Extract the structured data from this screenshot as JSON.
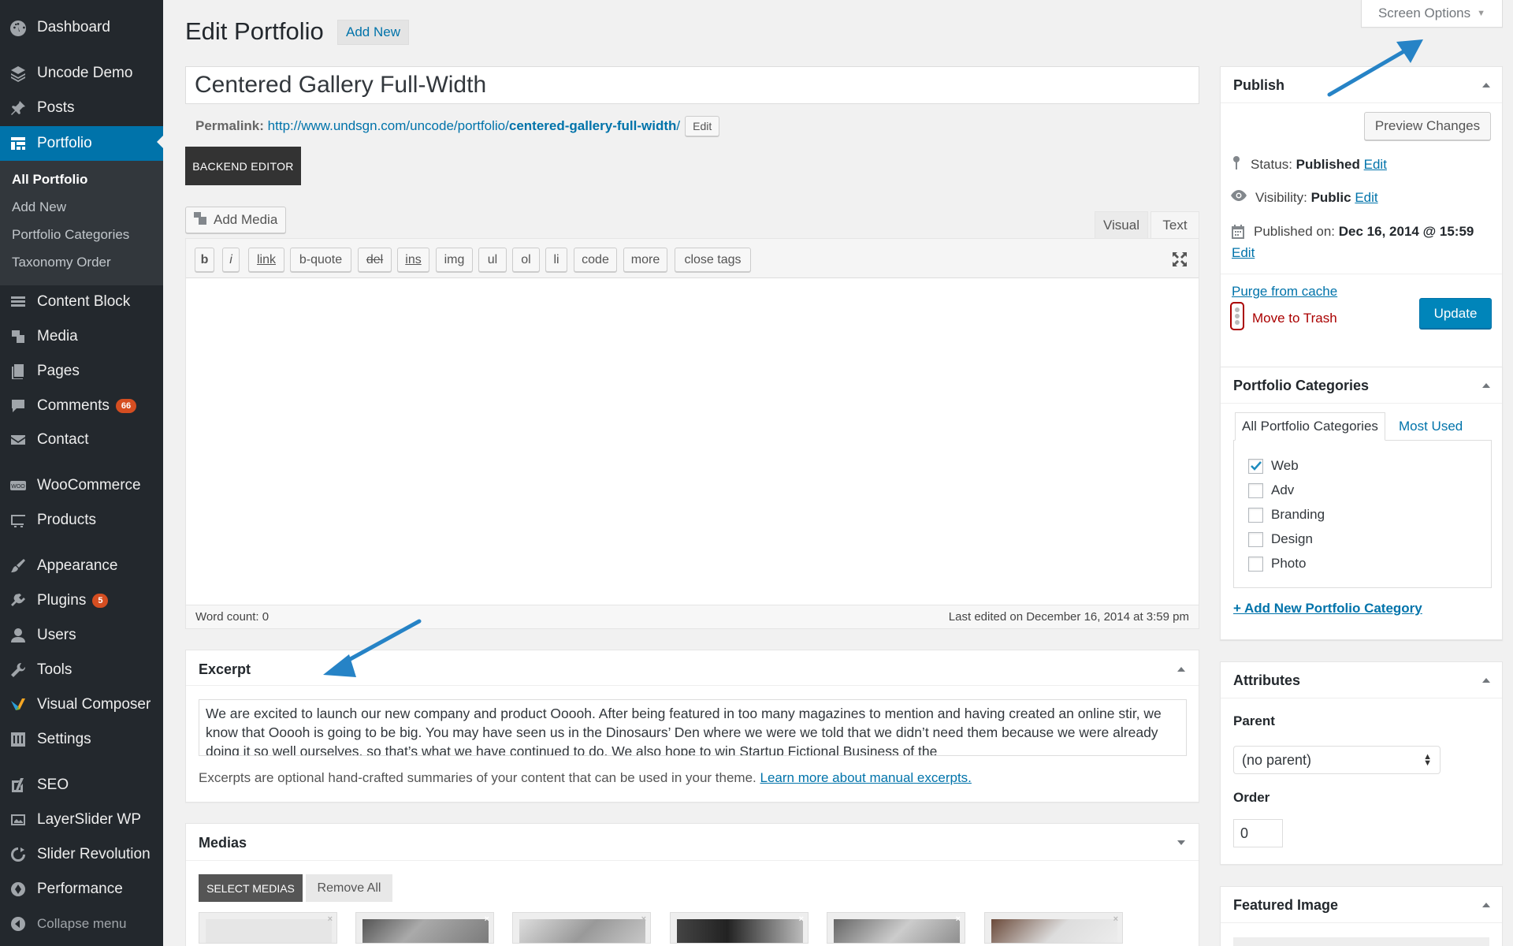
{
  "sidebar": {
    "items": [
      {
        "label": "Dashboard",
        "icon": "dashboard-icon"
      },
      {
        "label": "Uncode Demo",
        "icon": "layers-icon"
      },
      {
        "label": "Posts",
        "icon": "pin-icon"
      },
      {
        "label": "Portfolio",
        "icon": "portfolio-icon"
      },
      {
        "label": "Content Block",
        "icon": "block-icon"
      },
      {
        "label": "Media",
        "icon": "media-icon"
      },
      {
        "label": "Pages",
        "icon": "pages-icon"
      },
      {
        "label": "Comments",
        "icon": "comments-icon",
        "badge": "66"
      },
      {
        "label": "Contact",
        "icon": "mail-icon"
      },
      {
        "label": "WooCommerce",
        "icon": "woo-icon"
      },
      {
        "label": "Products",
        "icon": "products-icon"
      },
      {
        "label": "Appearance",
        "icon": "brush-icon"
      },
      {
        "label": "Plugins",
        "icon": "plugin-icon",
        "badge": "5"
      },
      {
        "label": "Users",
        "icon": "user-icon"
      },
      {
        "label": "Tools",
        "icon": "wrench-icon"
      },
      {
        "label": "Visual Composer",
        "icon": "vc-icon"
      },
      {
        "label": "Settings",
        "icon": "settings-icon"
      },
      {
        "label": "SEO",
        "icon": "seo-icon"
      },
      {
        "label": "LayerSlider WP",
        "icon": "slider-icon"
      },
      {
        "label": "Slider Revolution",
        "icon": "revolution-icon"
      },
      {
        "label": "Performance",
        "icon": "performance-icon"
      },
      {
        "label": "Collapse menu",
        "icon": "collapse-icon"
      }
    ],
    "submenu": [
      "All Portfolio",
      "Add New",
      "Portfolio Categories",
      "Taxonomy Order"
    ]
  },
  "header": {
    "title": "Edit Portfolio",
    "add_new": "Add New",
    "screen_options": "Screen Options"
  },
  "post": {
    "title": "Centered Gallery Full-Width",
    "permalink_label": "Permalink:",
    "permalink_base": "http://www.undsgn.com/uncode/portfolio/",
    "permalink_slug": "centered-gallery-full-width",
    "permalink_end": "/",
    "permalink_edit": "Edit",
    "backend_editor": "BACKEND EDITOR"
  },
  "editor": {
    "add_media": "Add Media",
    "tab_visual": "Visual",
    "tab_text": "Text",
    "buttons": [
      "b",
      "i",
      "link",
      "b-quote",
      "del",
      "ins",
      "img",
      "ul",
      "ol",
      "li",
      "code",
      "more",
      "close tags"
    ],
    "word_count": "Word count: 0",
    "last_edited": "Last edited on December 16, 2014 at 3:59 pm"
  },
  "excerpt": {
    "title": "Excerpt",
    "text": "We are excited to launch our new company and product Ooooh. After being featured in too many magazines to mention and having created an online stir, we know that Ooooh is going to be big. You may have seen us in the Dinosaurs’ Den where we were we told that we didn’t need them because we were already doing it so well ourselves, so that’s what we have continued to do. We also hope to win Startup Fictional Business of the",
    "help": "Excerpts are optional hand-crafted summaries of your content that can be used in your theme.",
    "help_link": "Learn more about manual excerpts."
  },
  "medias": {
    "title": "Medias",
    "select": "SELECT MEDIAS",
    "remove_all": "Remove All",
    "thumb_close": "×"
  },
  "publish": {
    "title": "Publish",
    "preview": "Preview Changes",
    "status_label": "Status:",
    "status_value": "Published",
    "visibility_label": "Visibility:",
    "visibility_value": "Public",
    "published_label": "Published on:",
    "published_value": "Dec 16, 2014 @ 15:59",
    "edit": "Edit",
    "purge": "Purge from cache",
    "trash": "Move to Trash",
    "update": "Update"
  },
  "categories": {
    "title": "Portfolio Categories",
    "tab_all": "All Portfolio Categories",
    "tab_most": "Most Used",
    "items": [
      {
        "label": "Web",
        "checked": true
      },
      {
        "label": "Adv",
        "checked": false
      },
      {
        "label": "Branding",
        "checked": false
      },
      {
        "label": "Design",
        "checked": false
      },
      {
        "label": "Photo",
        "checked": false
      }
    ],
    "add_new": "+ Add New Portfolio Category"
  },
  "attributes": {
    "title": "Attributes",
    "parent_label": "Parent",
    "parent_value": "(no parent)",
    "order_label": "Order",
    "order_value": "0"
  },
  "featured": {
    "title": "Featured Image"
  },
  "colors": {
    "sidebar": "#23282d",
    "accent": "#0073aa",
    "arrow": "#2683c6",
    "badge": "#d54e21"
  }
}
